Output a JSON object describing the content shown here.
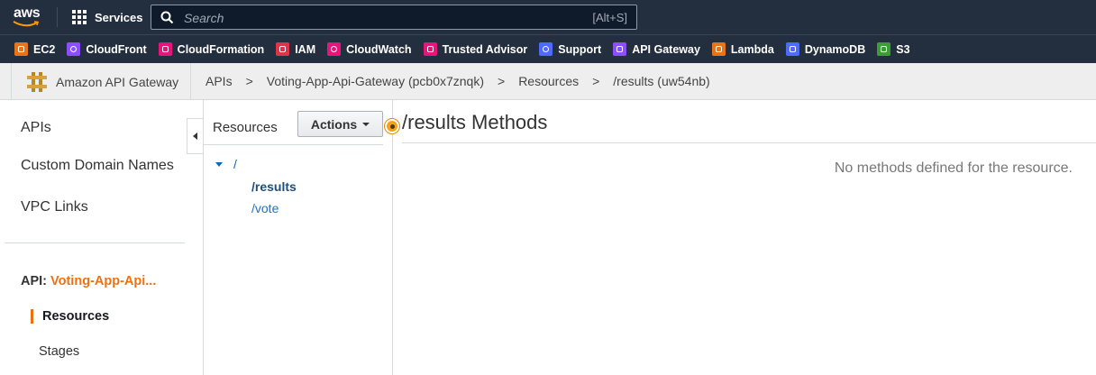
{
  "topnav": {
    "logo_text": "aws",
    "services_label": "Services",
    "search_placeholder": "Search",
    "search_shortcut": "[Alt+S]"
  },
  "favorites": [
    {
      "label": "EC2",
      "icon": "ec2-icon",
      "color": "#e8741a"
    },
    {
      "label": "CloudFront",
      "icon": "cloudfront-icon",
      "color": "#8c4fff"
    },
    {
      "label": "CloudFormation",
      "icon": "cloudformation-icon",
      "color": "#e7157b"
    },
    {
      "label": "IAM",
      "icon": "iam-icon",
      "color": "#dd344c"
    },
    {
      "label": "CloudWatch",
      "icon": "cloudwatch-icon",
      "color": "#e7157b"
    },
    {
      "label": "Trusted Advisor",
      "icon": "trusted-advisor-icon",
      "color": "#e7157b"
    },
    {
      "label": "Support",
      "icon": "support-icon",
      "color": "#4d6bfe"
    },
    {
      "label": "API Gateway",
      "icon": "api-gateway-icon",
      "color": "#8c4fff"
    },
    {
      "label": "Lambda",
      "icon": "lambda-icon",
      "color": "#e8741a"
    },
    {
      "label": "DynamoDB",
      "icon": "dynamodb-icon",
      "color": "#4d6bfe"
    },
    {
      "label": "S3",
      "icon": "s3-icon",
      "color": "#3f9c35"
    }
  ],
  "breadcrumb": {
    "service_name": "Amazon API Gateway",
    "items": [
      "APIs",
      "Voting-App-Api-Gateway (pcb0x7znqk)",
      "Resources",
      "/results (uw54nb)"
    ],
    "separator": ">"
  },
  "leftnav": {
    "apis": "APIs",
    "custom_domain_names": "Custom Domain Names",
    "vpc_links": "VPC Links",
    "api_prefix": "API:",
    "api_name": "Voting-App-Api...",
    "resources": "Resources",
    "stages": "Stages"
  },
  "resources_panel": {
    "title": "Resources",
    "actions_label": "Actions",
    "tree": {
      "root": "/",
      "children": [
        "/results",
        "/vote"
      ]
    }
  },
  "main": {
    "title": "/results Methods",
    "empty_message": "No methods defined for the resource."
  },
  "colors": {
    "nav_bg": "#232f3e",
    "accent_orange": "#ec7211",
    "link_blue": "#1166bb"
  }
}
